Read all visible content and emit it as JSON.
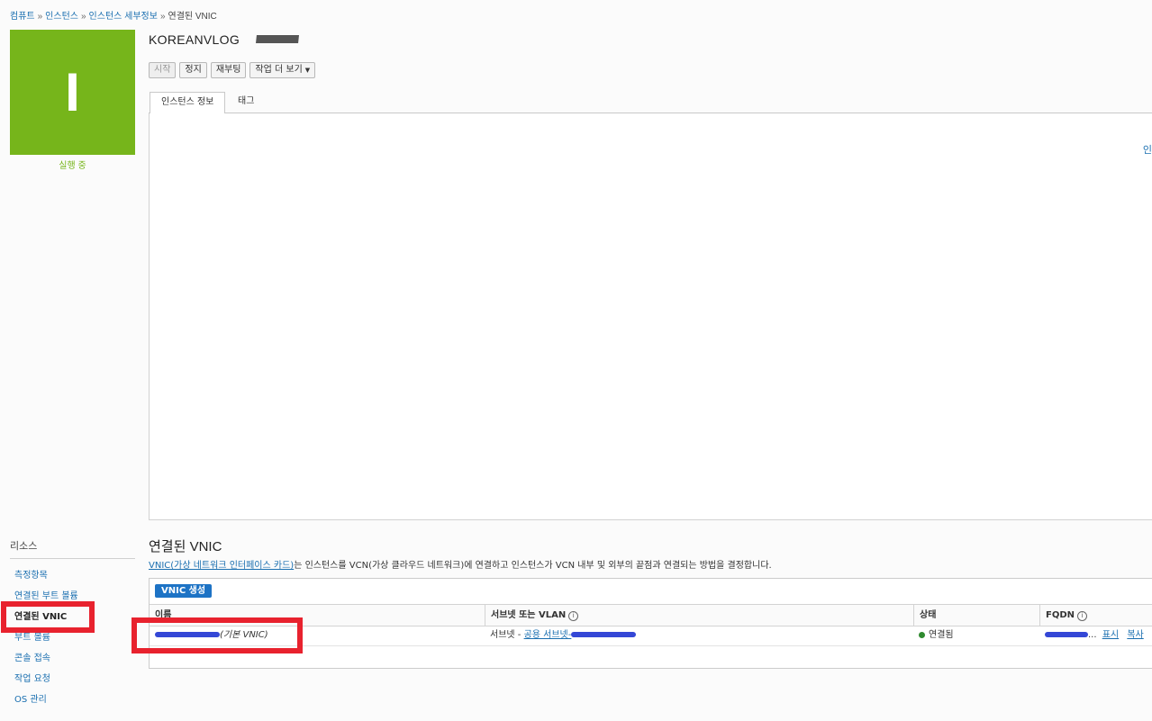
{
  "breadcrumb": {
    "items": [
      "컴퓨트",
      "인스턴스",
      "인스턴스 세부정보"
    ],
    "current": "연결된 VNIC",
    "separator": "»"
  },
  "instance": {
    "avatar_letter": "I",
    "avatar_color": "#76b51b",
    "state": "실행 중",
    "name": "KOREANVLOG"
  },
  "actions": {
    "start": "시작",
    "stop": "정지",
    "reboot": "재부팅",
    "more": "작업 더 보기"
  },
  "tabs": {
    "info": "인스턴스 정보",
    "tags": "태그"
  },
  "panel_edge_link": "인",
  "resources": {
    "heading": "리소스",
    "items": [
      "측정항목",
      "연결된 부트 볼륨",
      "연결된 VNIC",
      "부트 볼륨",
      "콘솔 접속",
      "작업 요청",
      "OS 관리"
    ],
    "active_index": 2
  },
  "vnic_section": {
    "title": "연결된 VNIC",
    "desc_link": "VNIC(가상 네트워크 인터페이스 카드)",
    "desc_text": "는 인스턴스를 VCN(가상 클라우드 네트워크)에 연결하고 인스턴스가 VCN 내부 및 외부의 끝점과 연결되는 방법을 결정합니다.",
    "create_button": "VNIC 생성",
    "columns": [
      "이름",
      "서브넷 또는 VLAN",
      "상태",
      "FQDN"
    ],
    "row": {
      "name_suffix": "(기본 VNIC)",
      "subnet_prefix": "서브넷 - ",
      "subnet_link": "공용 서브넷-",
      "state": "연결됨",
      "fqdn_ellipsis": "...",
      "show": "표시",
      "copy": "복사"
    }
  },
  "colors": {
    "accent": "#1d73c5",
    "highlight_box": "#e8222e",
    "status_ok": "#2f8a2f"
  }
}
